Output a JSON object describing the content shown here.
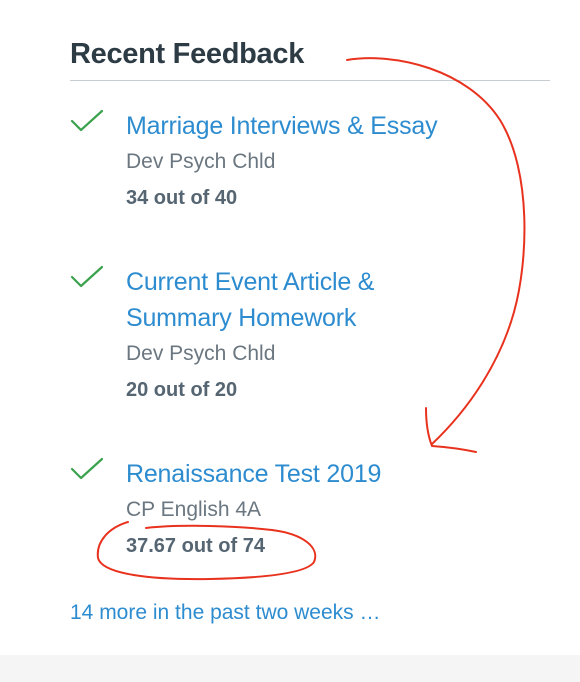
{
  "recent_feedback": {
    "heading": "Recent Feedback",
    "items": [
      {
        "title_line1": "Marriage Interviews & Essay",
        "title_line2": "",
        "course": "Dev Psych Chld",
        "score": "34 out of 40",
        "icon": "checkmark-icon"
      },
      {
        "title_line1": "Current Event Article &",
        "title_line2": "Summary Homework",
        "course": "Dev Psych Chld",
        "score": "20 out of 20",
        "icon": "checkmark-icon"
      },
      {
        "title_line1": "Renaissance Test 2019",
        "title_line2": "",
        "course": "CP English 4A",
        "score": "37.67 out of 74",
        "icon": "checkmark-icon"
      }
    ],
    "more_link": "14 more in the past two weeks …"
  },
  "colors": {
    "link": "#2d8ccf",
    "check": "#3aa14d",
    "heading": "#2d3b45",
    "annotation": "#e8321e"
  }
}
